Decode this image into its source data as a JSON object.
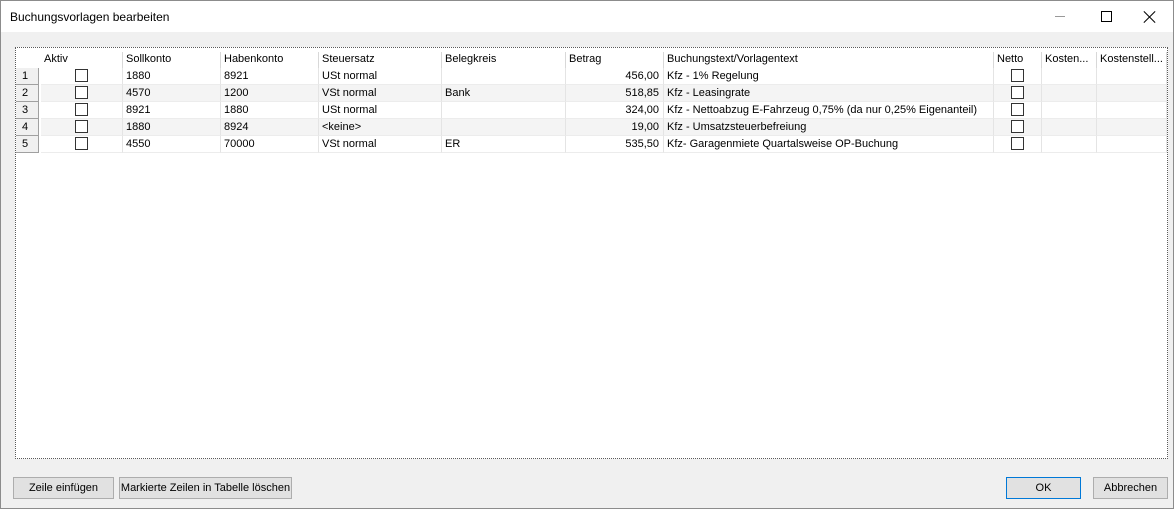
{
  "window": {
    "title": "Buchungsvorlagen bearbeiten"
  },
  "icons": {
    "minimize": "minimize-icon",
    "maximize": "maximize-icon",
    "close": "close-icon"
  },
  "table": {
    "columns": [
      "Aktiv",
      "Sollkonto",
      "Habenkonto",
      "Steuersatz",
      "Belegkreis",
      "Betrag",
      "Buchungstext/Vorlagentext",
      "Netto",
      "Kosten...",
      "Kostenstell..."
    ],
    "rows": [
      {
        "nr": "1",
        "aktiv": false,
        "soll": "1880",
        "haben": "8921",
        "steuer": "USt normal",
        "beleg": "",
        "betrag": "456,00",
        "text": "Kfz - 1% Regelung",
        "netto": false,
        "kosten": "",
        "kostenstelle": ""
      },
      {
        "nr": "2",
        "aktiv": false,
        "soll": "4570",
        "haben": "1200",
        "steuer": "VSt normal",
        "beleg": "Bank",
        "betrag": "518,85",
        "text": "Kfz - Leasingrate",
        "netto": false,
        "kosten": "",
        "kostenstelle": ""
      },
      {
        "nr": "3",
        "aktiv": false,
        "soll": "8921",
        "haben": "1880",
        "steuer": "USt normal",
        "beleg": "",
        "betrag": "324,00",
        "text": "Kfz - Nettoabzug E-Fahrzeug 0,75% (da nur 0,25% Eigenanteil)",
        "netto": false,
        "kosten": "",
        "kostenstelle": ""
      },
      {
        "nr": "4",
        "aktiv": false,
        "soll": "1880",
        "haben": "8924",
        "steuer": "<keine>",
        "beleg": "",
        "betrag": "19,00",
        "text": "Kfz - Umsatzsteuerbefreiung",
        "netto": false,
        "kosten": "",
        "kostenstelle": ""
      },
      {
        "nr": "5",
        "aktiv": false,
        "soll": "4550",
        "haben": "70000",
        "steuer": "VSt normal",
        "beleg": "ER",
        "betrag": "535,50",
        "text": "Kfz- Garagenmiete Quartalsweise OP-Buchung",
        "netto": false,
        "kosten": "",
        "kostenstelle": ""
      }
    ]
  },
  "buttons": {
    "insert_row": "Zeile einfügen",
    "delete_rows": "Markierte Zeilen in Tabelle löschen",
    "ok": "OK",
    "cancel": "Abbrechen"
  }
}
